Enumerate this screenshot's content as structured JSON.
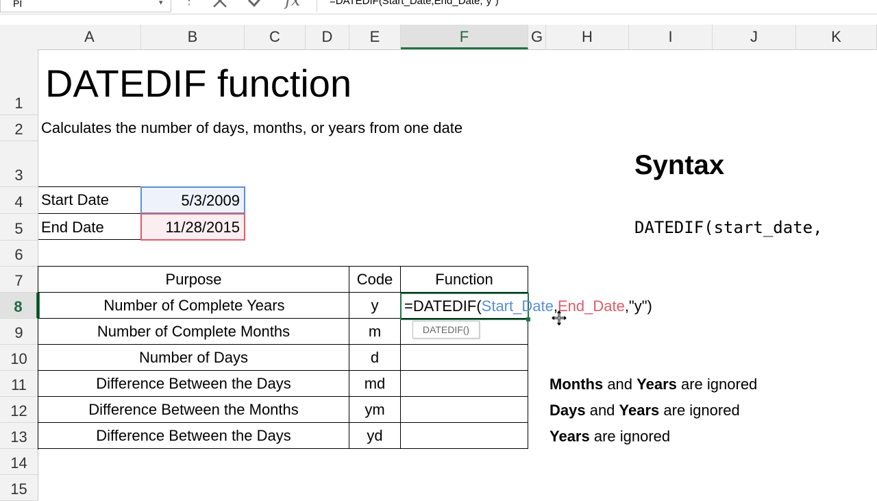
{
  "formula_bar": {
    "name_box": "PI",
    "formula": "=DATEDIF(Start_Date,End_Date,\"y\")"
  },
  "columns": [
    "A",
    "B",
    "C",
    "D",
    "E",
    "F",
    "G",
    "H",
    "I",
    "J",
    "K"
  ],
  "selected_column": "F",
  "rows": [
    "1",
    "2",
    "3",
    "4",
    "5",
    "6",
    "7",
    "8",
    "9",
    "10",
    "11",
    "12",
    "13",
    "14",
    "15"
  ],
  "selected_row": "8",
  "sheet": {
    "title": "DATEDIF function",
    "description": "Calculates the number of days, months, or years from one date",
    "syntax_title": "Syntax",
    "syntax_code": "DATEDIF(start_date,",
    "start_label": "Start Date",
    "start_value": "5/3/2009",
    "end_label": "End Date",
    "end_value": "11/28/2015"
  },
  "table": {
    "headers": {
      "purpose": "Purpose",
      "code": "Code",
      "function": "Function"
    },
    "rows": [
      {
        "purpose": "Number of Complete Years",
        "code": "y"
      },
      {
        "purpose": "Number of Complete Months",
        "code": "m"
      },
      {
        "purpose": "Number of Days",
        "code": "d"
      },
      {
        "purpose": "Difference Between the Days",
        "code": "md"
      },
      {
        "purpose": "Difference Between the Months",
        "code": "ym"
      },
      {
        "purpose": "Difference Between the Days",
        "code": "yd"
      }
    ]
  },
  "editing": {
    "prefix": "=DATEDIF(",
    "arg1": "Start_Date",
    "sep1": ",",
    "arg2": "End_Date",
    "suffix": ",\"y\")",
    "tooltip": "DATEDIF()"
  },
  "notes": [
    {
      "bold1": "Months",
      "mid": " and ",
      "bold2": "Years",
      "rest": " are ignored"
    },
    {
      "bold1": "Days",
      "mid": " and ",
      "bold2": "Years",
      "rest": " are ignored"
    },
    {
      "bold1": "Years",
      "mid": "",
      "bold2": "",
      "rest": " are ignored"
    }
  ],
  "colors": {
    "start_ref": "#5b8fd6",
    "end_ref": "#e05a6a",
    "selection": "#217346"
  }
}
